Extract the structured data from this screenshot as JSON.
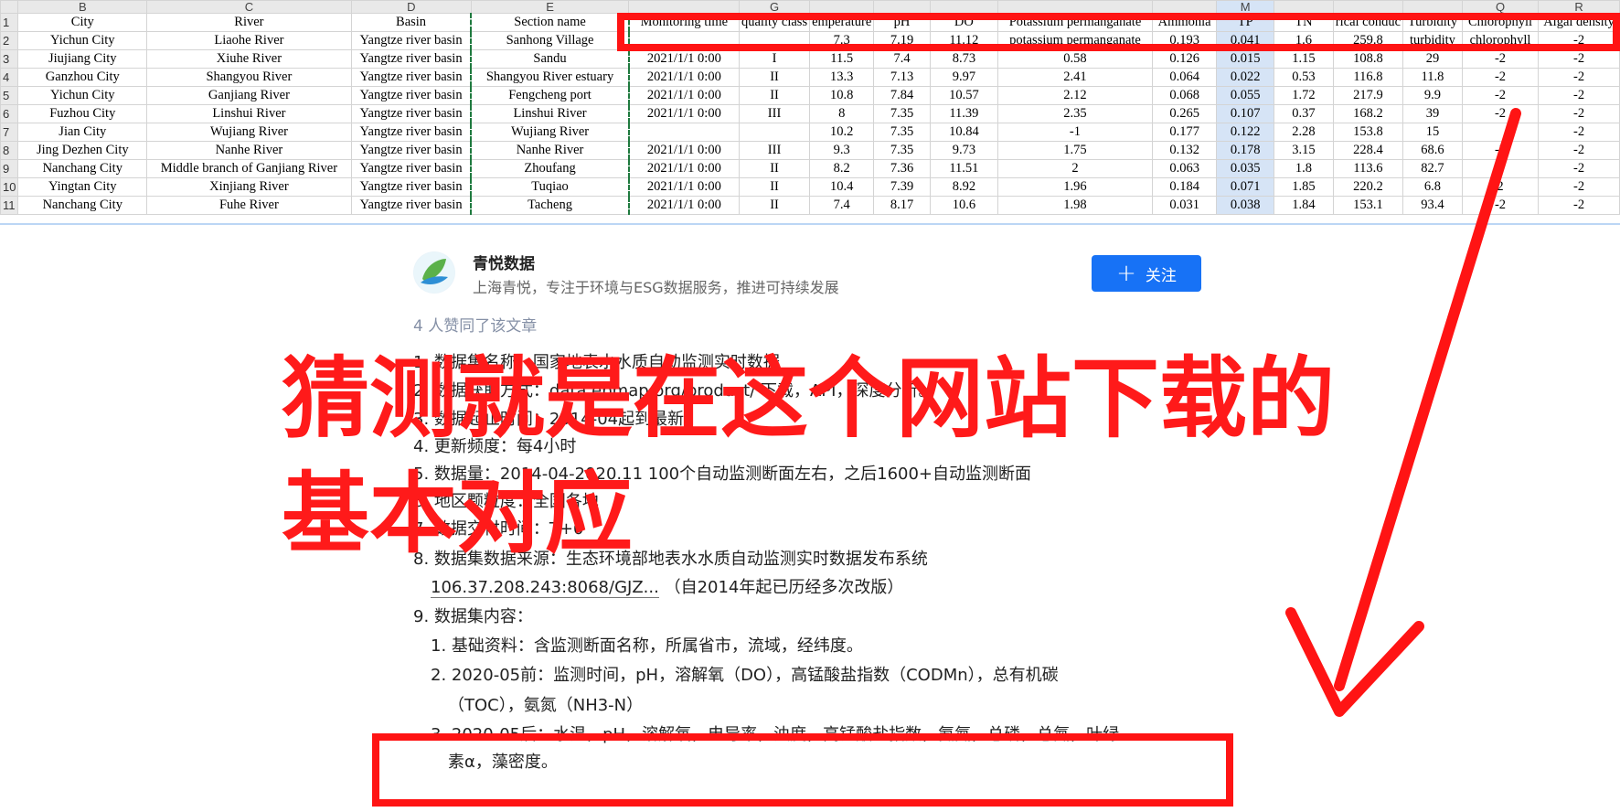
{
  "sheet": {
    "column_letters": [
      "",
      "B",
      "C",
      "D",
      "E",
      "",
      "G",
      "",
      "",
      "",
      "",
      "",
      "M",
      "",
      "",
      "",
      "Q",
      "R"
    ],
    "headers": [
      "City",
      "River",
      "Basin",
      "Section name",
      "Monitoring time",
      "quality class",
      "emperature",
      "pH",
      "DO",
      "Potassium permanganate",
      "Ammonia",
      "TP",
      "TN",
      "rical conduc",
      "Turbidity",
      "Chlorophyll",
      "Algal density"
    ],
    "row_numbers": [
      "1",
      "2",
      "3",
      "4",
      "5",
      "6",
      "7",
      "8",
      "9",
      "10",
      "11"
    ],
    "rows": [
      [
        "Yichun City",
        "Liaohe River",
        "Yangtze river basin",
        "Sanhong Village",
        "",
        "",
        "7.3",
        "7.19",
        "11.12",
        "potassium permanganate",
        "0.193",
        "0.041",
        "1.6",
        "259.8",
        "turbidity",
        "chlorophyll",
        "-2"
      ],
      [
        "Jiujiang City",
        "Xiuhe River",
        "Yangtze river basin",
        "Sandu",
        "2021/1/1 0:00",
        "I",
        "11.5",
        "7.4",
        "8.73",
        "0.58",
        "0.126",
        "0.015",
        "1.15",
        "108.8",
        "29",
        "-2",
        "-2"
      ],
      [
        "Ganzhou City",
        "Shangyou River",
        "Yangtze river basin",
        "Shangyou River estuary",
        "2021/1/1 0:00",
        "II",
        "13.3",
        "7.13",
        "9.97",
        "2.41",
        "0.064",
        "0.022",
        "0.53",
        "116.8",
        "11.8",
        "-2",
        "-2"
      ],
      [
        "Yichun City",
        "Ganjiang River",
        "Yangtze river basin",
        "Fengcheng port",
        "2021/1/1 0:00",
        "II",
        "10.8",
        "7.84",
        "10.57",
        "2.12",
        "0.068",
        "0.055",
        "1.72",
        "217.9",
        "9.9",
        "-2",
        "-2"
      ],
      [
        "Fuzhou City",
        "Linshui River",
        "Yangtze river basin",
        "Linshui River",
        "2021/1/1 0:00",
        "III",
        "8",
        "7.35",
        "11.39",
        "2.35",
        "0.265",
        "0.107",
        "0.37",
        "168.2",
        "39",
        "-2",
        "-2"
      ],
      [
        "Jian City",
        "Wujiang River",
        "Yangtze river basin",
        "Wujiang River",
        "",
        "",
        "10.2",
        "7.35",
        "10.84",
        "-1",
        "0.177",
        "0.122",
        "2.28",
        "153.8",
        "15",
        "",
        "-2"
      ],
      [
        "Jing Dezhen City",
        "Nanhe River",
        "Yangtze river basin",
        "Nanhe River",
        "2021/1/1 0:00",
        "III",
        "9.3",
        "7.35",
        "9.73",
        "1.75",
        "0.132",
        "0.178",
        "3.15",
        "228.4",
        "68.6",
        "-2",
        "-2"
      ],
      [
        "Nanchang City",
        "Middle branch of Ganjiang River",
        "Yangtze river basin",
        "Zhoufang",
        "2021/1/1 0:00",
        "II",
        "8.2",
        "7.36",
        "11.51",
        "2",
        "0.063",
        "0.035",
        "1.8",
        "113.6",
        "82.7",
        "2",
        "-2"
      ],
      [
        "Yingtan City",
        "Xinjiang River",
        "Yangtze river basin",
        "Tuqiao",
        "2021/1/1 0:00",
        "II",
        "10.4",
        "7.39",
        "8.92",
        "1.96",
        "0.184",
        "0.071",
        "1.85",
        "220.2",
        "6.8",
        "2",
        "-2"
      ],
      [
        "Nanchang City",
        "Fuhe River",
        "Yangtze river basin",
        "Tacheng",
        "2021/1/1 0:00",
        "II",
        "7.4",
        "8.17",
        "10.6",
        "1.98",
        "0.031",
        "0.038",
        "1.84",
        "153.1",
        "93.4",
        "-2",
        "-2"
      ]
    ]
  },
  "author": {
    "name": "青悦数据",
    "description": "上海青悦，专注于环境与ESG数据服务，推进可持续发展",
    "follow_label": "关注",
    "likes": "4 人赞同了该文章"
  },
  "article_lines": [
    {
      "num": "1.",
      "text": "数据集名称：国家地表水水质自动监测实时数据"
    },
    {
      "num": "2.",
      "text": "数据获取方式：data.epmap.org/product/ 下载，API，深度分析。"
    },
    {
      "num": "3.",
      "text": "数据起止时间：2014-04起到最新"
    },
    {
      "num": "4.",
      "text": "更新频度：每4小时"
    },
    {
      "num": "5.",
      "text": "数据量：2014-04-2020.11 100个自动监测断面左右，之后1600+自动监测断面"
    },
    {
      "num": "6.",
      "text": "地区颗粒度：全国各地"
    },
    {
      "num": "7.",
      "text": "数据交付时间：T+0"
    },
    {
      "num": "8.",
      "text": "数据集数据来源：生态环境部地表水水质自动监测实时数据发布系统"
    },
    {
      "num": "",
      "text": "106.37.208.243:8068/GJZ...",
      "suffix": "（自2014年起已历经多次改版）"
    },
    {
      "num": "9.",
      "text": "数据集内容："
    },
    {
      "num": "1.",
      "text": "基础资料：含监测断面名称，所属省市，流域，经纬度。"
    },
    {
      "num": "2.",
      "text": "2020-05前：监测时间，pH，溶解氧（DO），高锰酸盐指数（CODMn），总有机碳"
    },
    {
      "num": "",
      "text": "（TOC），氨氮（NH3-N）"
    },
    {
      "num": "3.",
      "text": "2020-05后：水温，pH，溶解氧，电导率，浊度，高锰酸盐指数，氨氮，总磷，总氮，叶绿"
    },
    {
      "num": "",
      "text": "素α，藻密度。"
    }
  ],
  "annotation": {
    "line1": "猜测就是在这个网站下载的",
    "line2": "基本对应",
    "color": "#ff1414"
  }
}
